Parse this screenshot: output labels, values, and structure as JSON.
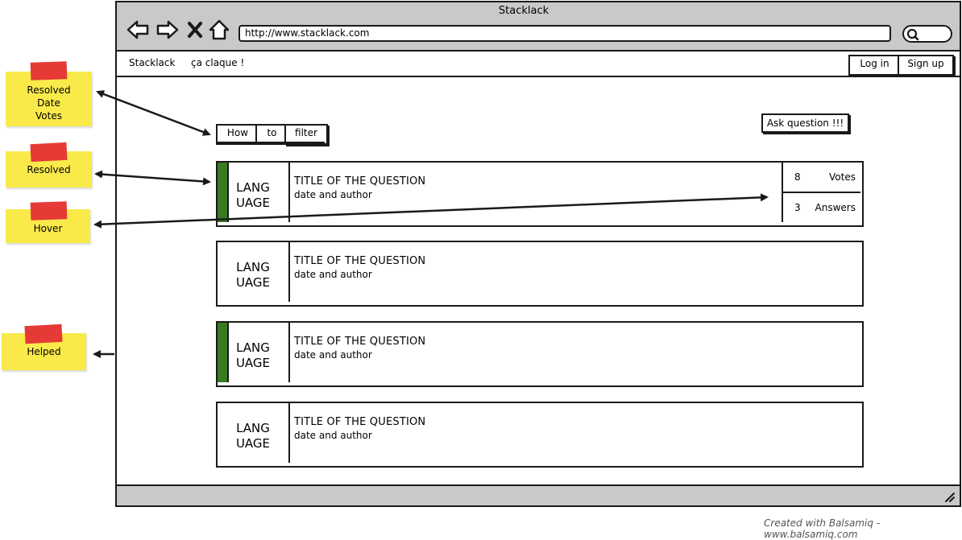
{
  "window": {
    "title": "Stacklack",
    "url": "http://www.stacklack.com"
  },
  "header": {
    "brand": "Stacklack",
    "tagline": "ça claque !",
    "login_label": "Log in",
    "signup_label": "Sign up"
  },
  "filter": {
    "segments": [
      "How",
      "to",
      "filter"
    ]
  },
  "ask_label": "Ask question !!!",
  "questions": [
    {
      "language": "LANG UAGE",
      "title": "TITLE OF THE QUESTION",
      "meta": "date and author",
      "resolved": true,
      "votes": "8",
      "votes_label": "Votes",
      "answers": "3",
      "answers_label": "Answers"
    },
    {
      "language": "LANG UAGE",
      "title": "TITLE OF THE QUESTION",
      "meta": "date and author",
      "resolved": false
    },
    {
      "language": "LANG UAGE",
      "title": "TITLE OF THE QUESTION",
      "meta": "date and author",
      "resolved": true
    },
    {
      "language": "LANG UAGE",
      "title": "TITLE OF THE QUESTION",
      "meta": "date and author",
      "resolved": false
    }
  ],
  "notes": [
    {
      "text": "Resolved Date Votes"
    },
    {
      "text": "Resolved"
    },
    {
      "text": "Hover"
    },
    {
      "text": "Helped"
    }
  ],
  "footer_credit": "Created with Balsamiq - www.balsamiq.com",
  "colors": {
    "frame_gray": "#c9c9c9",
    "resolved_green": "#3a7a23",
    "note_yellow": "#f9ea4a",
    "tape_red": "#e53a36"
  },
  "icons": [
    "back-arrow-icon",
    "forward-arrow-icon",
    "stop-icon",
    "home-icon",
    "search-icon",
    "resize-grip-icon"
  ]
}
